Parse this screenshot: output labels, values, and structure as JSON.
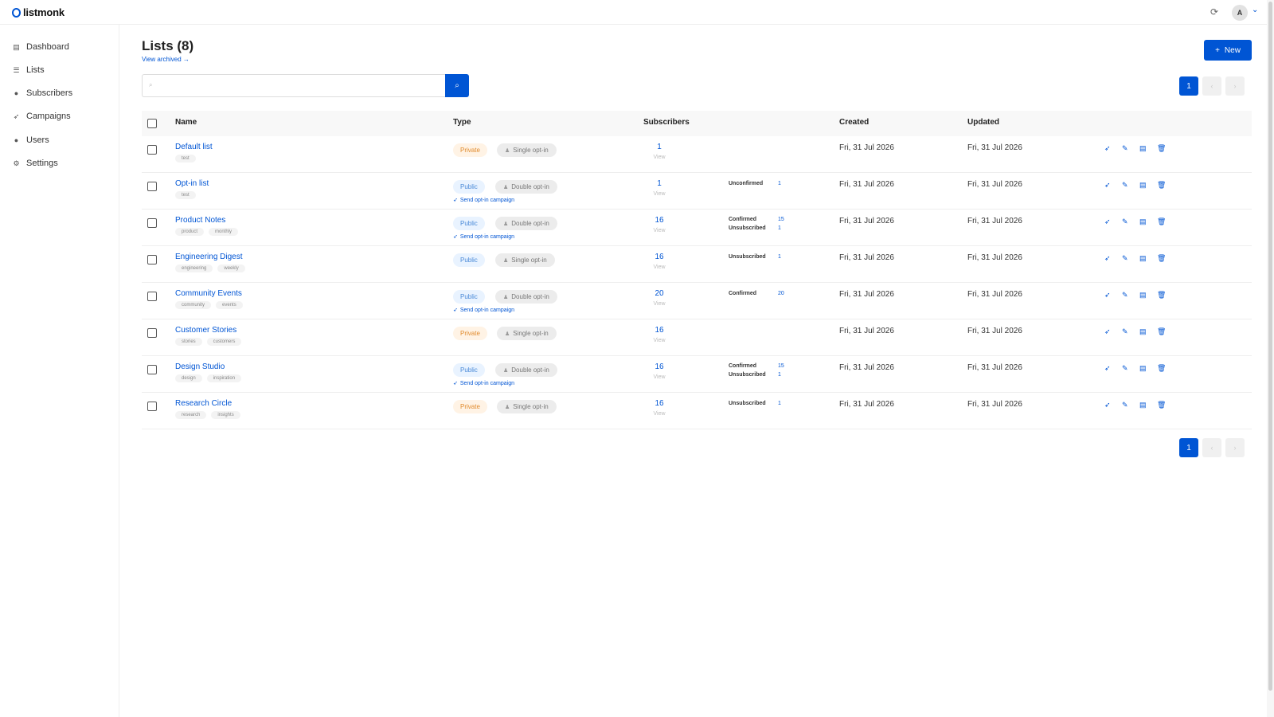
{
  "app": {
    "logo_text": "listmonk",
    "avatar_letter": "A",
    "refresh_icon": "refresh-icon",
    "chevron_icon": "chevron-down-icon",
    "accent_color": "#0055d4"
  },
  "sidebar": {
    "items": [
      {
        "label": "Dashboard",
        "icon": "dashboard-icon"
      },
      {
        "label": "Lists",
        "icon": "list-icon"
      },
      {
        "label": "Subscribers",
        "icon": "users-icon"
      },
      {
        "label": "Campaigns",
        "icon": "rocket-icon"
      },
      {
        "label": "Users",
        "icon": "user-icon"
      },
      {
        "label": "Settings",
        "icon": "gear-icon"
      }
    ]
  },
  "header": {
    "title": "Lists (8)",
    "view_archived": "View archived →",
    "new_button": "New",
    "new_icon": "+"
  },
  "search": {
    "placeholder": "",
    "value": ""
  },
  "pagination": {
    "current": "1",
    "prev": "‹",
    "next": "›"
  },
  "table": {
    "headers": [
      "Name",
      "Type",
      "Subscribers",
      "Created",
      "Updated"
    ],
    "send_optin_label": "Send opt-in campaign",
    "view_label": "View",
    "rows": [
      {
        "name": "Default list",
        "tags": [
          "test"
        ],
        "visibility": "Private",
        "optin": "Single opt-in",
        "send_optin": false,
        "subscribers": "1",
        "stats": [],
        "created": "Fri, 31 Jul 2026",
        "updated": "Fri, 31 Jul 2026"
      },
      {
        "name": "Opt-in list",
        "tags": [
          "test"
        ],
        "visibility": "Public",
        "optin": "Double opt-in",
        "send_optin": true,
        "subscribers": "1",
        "stats": [
          {
            "label": "Unconfirmed",
            "value": "1"
          }
        ],
        "created": "Fri, 31 Jul 2026",
        "updated": "Fri, 31 Jul 2026"
      },
      {
        "name": "Product Notes",
        "tags": [
          "product",
          "monthly"
        ],
        "visibility": "Public",
        "optin": "Double opt-in",
        "send_optin": true,
        "subscribers": "16",
        "stats": [
          {
            "label": "Confirmed",
            "value": "15"
          },
          {
            "label": "Unsubscribed",
            "value": "1"
          }
        ],
        "created": "Fri, 31 Jul 2026",
        "updated": "Fri, 31 Jul 2026"
      },
      {
        "name": "Engineering Digest",
        "tags": [
          "engineering",
          "weekly"
        ],
        "visibility": "Public",
        "optin": "Single opt-in",
        "send_optin": false,
        "subscribers": "16",
        "stats": [
          {
            "label": "Unsubscribed",
            "value": "1"
          }
        ],
        "created": "Fri, 31 Jul 2026",
        "updated": "Fri, 31 Jul 2026"
      },
      {
        "name": "Community Events",
        "tags": [
          "community",
          "events"
        ],
        "visibility": "Public",
        "optin": "Double opt-in",
        "send_optin": true,
        "subscribers": "20",
        "stats": [
          {
            "label": "Confirmed",
            "value": "20"
          }
        ],
        "created": "Fri, 31 Jul 2026",
        "updated": "Fri, 31 Jul 2026"
      },
      {
        "name": "Customer Stories",
        "tags": [
          "stories",
          "customers"
        ],
        "visibility": "Private",
        "optin": "Single opt-in",
        "send_optin": false,
        "subscribers": "16",
        "stats": [],
        "created": "Fri, 31 Jul 2026",
        "updated": "Fri, 31 Jul 2026"
      },
      {
        "name": "Design Studio",
        "tags": [
          "design",
          "inspiration"
        ],
        "visibility": "Public",
        "optin": "Double opt-in",
        "send_optin": true,
        "subscribers": "16",
        "stats": [
          {
            "label": "Confirmed",
            "value": "15"
          },
          {
            "label": "Unsubscribed",
            "value": "1"
          }
        ],
        "created": "Fri, 31 Jul 2026",
        "updated": "Fri, 31 Jul 2026"
      },
      {
        "name": "Research Circle",
        "tags": [
          "research",
          "insights"
        ],
        "visibility": "Private",
        "optin": "Single opt-in",
        "send_optin": false,
        "subscribers": "16",
        "stats": [
          {
            "label": "Unsubscribed",
            "value": "1"
          }
        ],
        "created": "Fri, 31 Jul 2026",
        "updated": "Fri, 31 Jul 2026"
      }
    ],
    "row_actions": [
      "rocket-icon",
      "pencil-icon",
      "document-icon",
      "trash-icon"
    ]
  }
}
